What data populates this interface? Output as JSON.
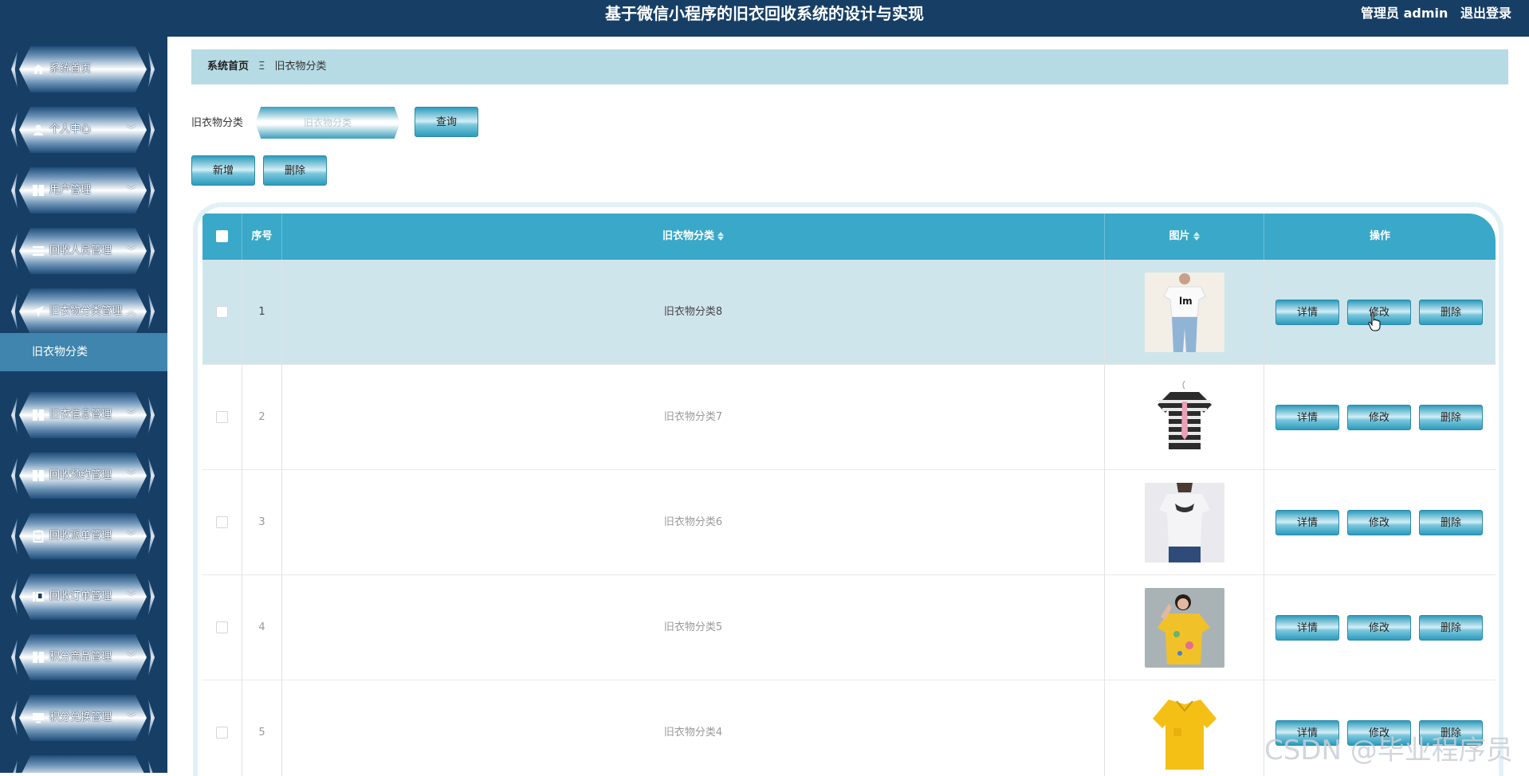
{
  "header": {
    "title": "基于微信小程序的旧衣回收系统的设计与实现",
    "user_label": "管理员 admin",
    "logout_label": "退出登录"
  },
  "sidebar": {
    "items": [
      {
        "label": "系统首页",
        "icon": "home-icon"
      },
      {
        "label": "个人中心",
        "icon": "user-icon"
      },
      {
        "label": "用户管理",
        "icon": "grid-icon"
      },
      {
        "label": "回收人员管理",
        "icon": "list-icon"
      },
      {
        "label": "旧衣物分类管理",
        "icon": "paper-plane-icon"
      },
      {
        "label": "旧衣信息管理",
        "icon": "grid-icon"
      },
      {
        "label": "回收预约管理",
        "icon": "grid-icon"
      },
      {
        "label": "回收派单管理",
        "icon": "clipboard-icon"
      },
      {
        "label": "回收订单管理",
        "icon": "book-icon"
      },
      {
        "label": "积分商品管理",
        "icon": "grid-icon"
      },
      {
        "label": "积分兑换管理",
        "icon": "monitor-icon"
      }
    ],
    "sub_item": "旧衣物分类"
  },
  "breadcrumb": {
    "home": "系统首页",
    "separator": "Ξ",
    "current": "旧衣物分类"
  },
  "search": {
    "label": "旧衣物分类",
    "placeholder": "旧衣物分类",
    "query_label": "查询"
  },
  "actions": {
    "add_label": "新增",
    "delete_label": "删除"
  },
  "table": {
    "columns": [
      "序号",
      "旧衣物分类",
      "图片",
      "操作"
    ],
    "rows": [
      {
        "index": "1",
        "category": "旧衣物分类8"
      },
      {
        "index": "2",
        "category": "旧衣物分类7"
      },
      {
        "index": "3",
        "category": "旧衣物分类6"
      },
      {
        "index": "4",
        "category": "旧衣物分类5"
      },
      {
        "index": "5",
        "category": "旧衣物分类4"
      }
    ],
    "row_actions": {
      "detail": "详情",
      "edit": "修改",
      "delete": "删除"
    }
  },
  "watermark": "CSDN @毕业程序员",
  "colors": {
    "topbar": "#173f66",
    "accent": "#3aa8c8",
    "breadcrumb_bg": "#b6dbe4",
    "active_row": "#cfe5ec"
  }
}
